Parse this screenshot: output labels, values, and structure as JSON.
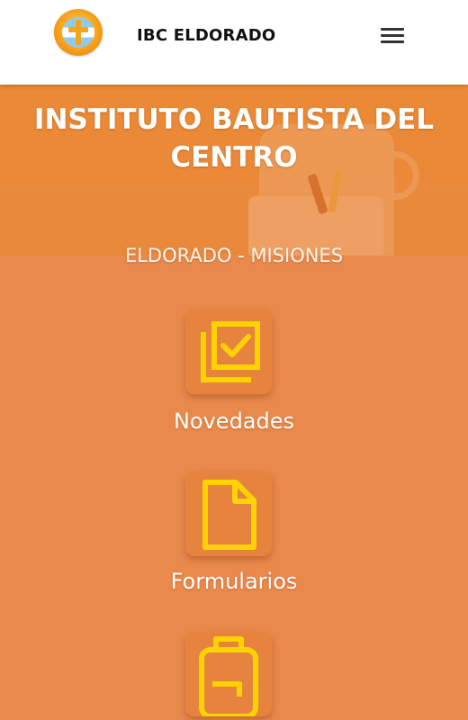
{
  "header": {
    "brand": "IBC ELDORADO",
    "logo_icon": "cross-shield-logo",
    "menu_icon": "hamburger-menu-icon"
  },
  "hero": {
    "title_line1": "INSTITUTO BAUTISTA DEL",
    "title_line2": "CENTRO",
    "subtitle": "ELDORADO - MISIONES"
  },
  "menu": {
    "items": [
      {
        "label": "Novedades",
        "icon": "checked-stack-icon"
      },
      {
        "label": "Formularios",
        "icon": "document-icon"
      },
      {
        "label": "",
        "icon": "backpack-icon"
      }
    ]
  },
  "colors": {
    "background": "#e98a4c",
    "hero": "#ea8a36",
    "icon_yellow": "#ffd200",
    "header_bg": "#ffffff"
  }
}
